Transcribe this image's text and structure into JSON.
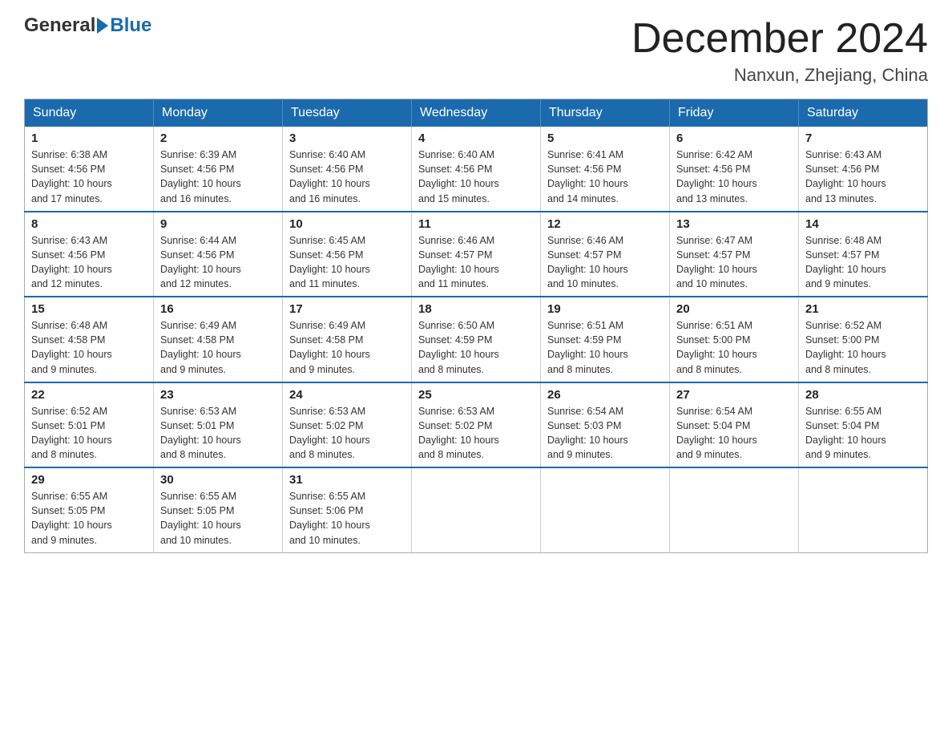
{
  "header": {
    "logo_general": "General",
    "logo_blue": "Blue",
    "month_title": "December 2024",
    "location": "Nanxun, Zhejiang, China"
  },
  "weekdays": [
    "Sunday",
    "Monday",
    "Tuesday",
    "Wednesday",
    "Thursday",
    "Friday",
    "Saturday"
  ],
  "weeks": [
    [
      {
        "day": "1",
        "sunrise": "6:38 AM",
        "sunset": "4:56 PM",
        "daylight": "10 hours and 17 minutes."
      },
      {
        "day": "2",
        "sunrise": "6:39 AM",
        "sunset": "4:56 PM",
        "daylight": "10 hours and 16 minutes."
      },
      {
        "day": "3",
        "sunrise": "6:40 AM",
        "sunset": "4:56 PM",
        "daylight": "10 hours and 16 minutes."
      },
      {
        "day": "4",
        "sunrise": "6:40 AM",
        "sunset": "4:56 PM",
        "daylight": "10 hours and 15 minutes."
      },
      {
        "day": "5",
        "sunrise": "6:41 AM",
        "sunset": "4:56 PM",
        "daylight": "10 hours and 14 minutes."
      },
      {
        "day": "6",
        "sunrise": "6:42 AM",
        "sunset": "4:56 PM",
        "daylight": "10 hours and 13 minutes."
      },
      {
        "day": "7",
        "sunrise": "6:43 AM",
        "sunset": "4:56 PM",
        "daylight": "10 hours and 13 minutes."
      }
    ],
    [
      {
        "day": "8",
        "sunrise": "6:43 AM",
        "sunset": "4:56 PM",
        "daylight": "10 hours and 12 minutes."
      },
      {
        "day": "9",
        "sunrise": "6:44 AM",
        "sunset": "4:56 PM",
        "daylight": "10 hours and 12 minutes."
      },
      {
        "day": "10",
        "sunrise": "6:45 AM",
        "sunset": "4:56 PM",
        "daylight": "10 hours and 11 minutes."
      },
      {
        "day": "11",
        "sunrise": "6:46 AM",
        "sunset": "4:57 PM",
        "daylight": "10 hours and 11 minutes."
      },
      {
        "day": "12",
        "sunrise": "6:46 AM",
        "sunset": "4:57 PM",
        "daylight": "10 hours and 10 minutes."
      },
      {
        "day": "13",
        "sunrise": "6:47 AM",
        "sunset": "4:57 PM",
        "daylight": "10 hours and 10 minutes."
      },
      {
        "day": "14",
        "sunrise": "6:48 AM",
        "sunset": "4:57 PM",
        "daylight": "10 hours and 9 minutes."
      }
    ],
    [
      {
        "day": "15",
        "sunrise": "6:48 AM",
        "sunset": "4:58 PM",
        "daylight": "10 hours and 9 minutes."
      },
      {
        "day": "16",
        "sunrise": "6:49 AM",
        "sunset": "4:58 PM",
        "daylight": "10 hours and 9 minutes."
      },
      {
        "day": "17",
        "sunrise": "6:49 AM",
        "sunset": "4:58 PM",
        "daylight": "10 hours and 9 minutes."
      },
      {
        "day": "18",
        "sunrise": "6:50 AM",
        "sunset": "4:59 PM",
        "daylight": "10 hours and 8 minutes."
      },
      {
        "day": "19",
        "sunrise": "6:51 AM",
        "sunset": "4:59 PM",
        "daylight": "10 hours and 8 minutes."
      },
      {
        "day": "20",
        "sunrise": "6:51 AM",
        "sunset": "5:00 PM",
        "daylight": "10 hours and 8 minutes."
      },
      {
        "day": "21",
        "sunrise": "6:52 AM",
        "sunset": "5:00 PM",
        "daylight": "10 hours and 8 minutes."
      }
    ],
    [
      {
        "day": "22",
        "sunrise": "6:52 AM",
        "sunset": "5:01 PM",
        "daylight": "10 hours and 8 minutes."
      },
      {
        "day": "23",
        "sunrise": "6:53 AM",
        "sunset": "5:01 PM",
        "daylight": "10 hours and 8 minutes."
      },
      {
        "day": "24",
        "sunrise": "6:53 AM",
        "sunset": "5:02 PM",
        "daylight": "10 hours and 8 minutes."
      },
      {
        "day": "25",
        "sunrise": "6:53 AM",
        "sunset": "5:02 PM",
        "daylight": "10 hours and 8 minutes."
      },
      {
        "day": "26",
        "sunrise": "6:54 AM",
        "sunset": "5:03 PM",
        "daylight": "10 hours and 9 minutes."
      },
      {
        "day": "27",
        "sunrise": "6:54 AM",
        "sunset": "5:04 PM",
        "daylight": "10 hours and 9 minutes."
      },
      {
        "day": "28",
        "sunrise": "6:55 AM",
        "sunset": "5:04 PM",
        "daylight": "10 hours and 9 minutes."
      }
    ],
    [
      {
        "day": "29",
        "sunrise": "6:55 AM",
        "sunset": "5:05 PM",
        "daylight": "10 hours and 9 minutes."
      },
      {
        "day": "30",
        "sunrise": "6:55 AM",
        "sunset": "5:05 PM",
        "daylight": "10 hours and 10 minutes."
      },
      {
        "day": "31",
        "sunrise": "6:55 AM",
        "sunset": "5:06 PM",
        "daylight": "10 hours and 10 minutes."
      },
      null,
      null,
      null,
      null
    ]
  ]
}
